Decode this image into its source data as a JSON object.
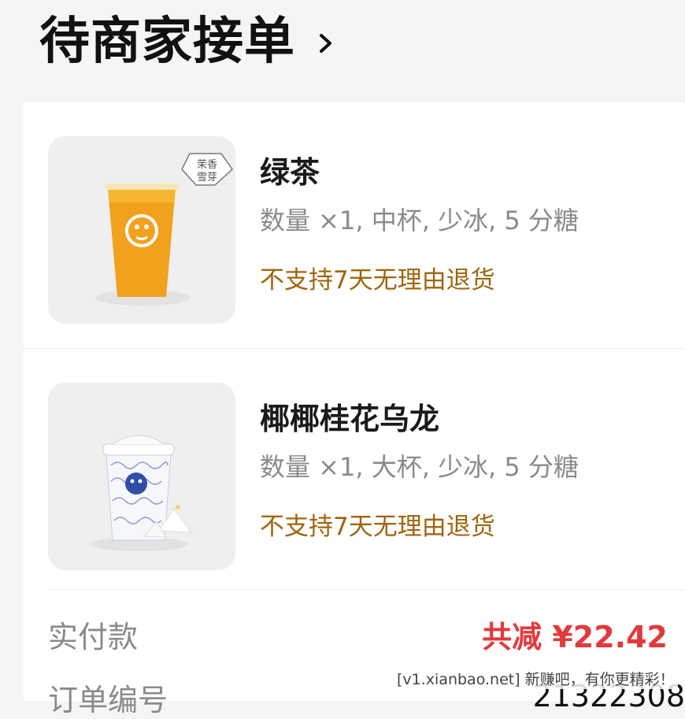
{
  "header": {
    "title": "待商家接单"
  },
  "items": [
    {
      "name": "绿茶",
      "spec": "数量 ×1, 中杯, 少冰, 5 分糖",
      "notice": "不支持7天无理由退货",
      "badge_line1": "茉香",
      "badge_line2": "雪芽"
    },
    {
      "name": "椰椰桂花乌龙",
      "spec": "数量 ×1, 大杯, 少冰, 5 分糖",
      "notice": "不支持7天无理由退货"
    }
  ],
  "summary": {
    "paid_label": "实付款",
    "paid_value": "共减 ¥22.42",
    "order_label": "订单编号",
    "order_value": "21322308"
  },
  "watermark": "[v1.xianbao.net] 新赚吧，有你更精彩！",
  "colors": {
    "price": "#e4393c",
    "notice": "#a0650e"
  }
}
